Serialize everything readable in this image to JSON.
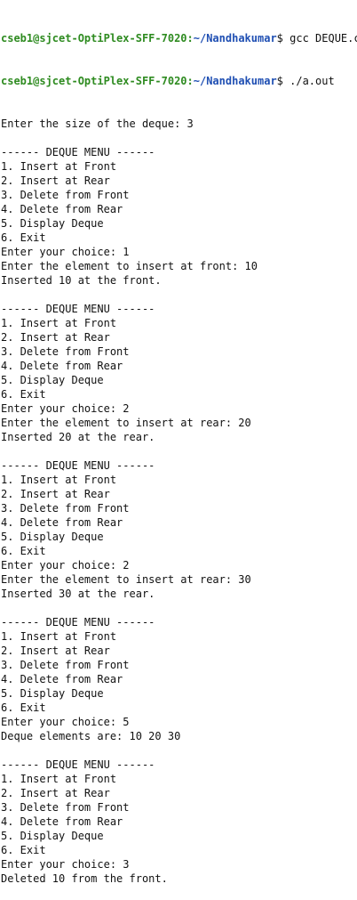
{
  "colors": {
    "background": "#ffffff",
    "text": "#111111",
    "prompt_user": "#2e8b20",
    "prompt_path": "#1f4fb3"
  },
  "prompts": [
    {
      "user_host": "cseb1@sjcet-OptiPlex-SFF-7020",
      "sep": ":",
      "path": "~/Nandhakumar",
      "symbol": "$",
      "command": " gcc DEQUE.c"
    },
    {
      "user_host": "cseb1@sjcet-OptiPlex-SFF-7020",
      "sep": ":",
      "path": "~/Nandhakumar",
      "symbol": "$",
      "command": " ./a.out"
    }
  ],
  "output": [
    "Enter the size of the deque: 3",
    "",
    "------ DEQUE MENU ------",
    "1. Insert at Front",
    "2. Insert at Rear",
    "3. Delete from Front",
    "4. Delete from Rear",
    "5. Display Deque",
    "6. Exit",
    "Enter your choice: 1",
    "Enter the element to insert at front: 10",
    "Inserted 10 at the front.",
    "",
    "------ DEQUE MENU ------",
    "1. Insert at Front",
    "2. Insert at Rear",
    "3. Delete from Front",
    "4. Delete from Rear",
    "5. Display Deque",
    "6. Exit",
    "Enter your choice: 2",
    "Enter the element to insert at rear: 20",
    "Inserted 20 at the rear.",
    "",
    "------ DEQUE MENU ------",
    "1. Insert at Front",
    "2. Insert at Rear",
    "3. Delete from Front",
    "4. Delete from Rear",
    "5. Display Deque",
    "6. Exit",
    "Enter your choice: 2",
    "Enter the element to insert at rear: 30",
    "Inserted 30 at the rear.",
    "",
    "------ DEQUE MENU ------",
    "1. Insert at Front",
    "2. Insert at Rear",
    "3. Delete from Front",
    "4. Delete from Rear",
    "5. Display Deque",
    "6. Exit",
    "Enter your choice: 5",
    "Deque elements are: 10 20 30",
    "",
    "------ DEQUE MENU ------",
    "1. Insert at Front",
    "2. Insert at Rear",
    "3. Delete from Front",
    "4. Delete from Rear",
    "5. Display Deque",
    "6. Exit",
    "Enter your choice: 3",
    "Deleted 10 from the front."
  ]
}
